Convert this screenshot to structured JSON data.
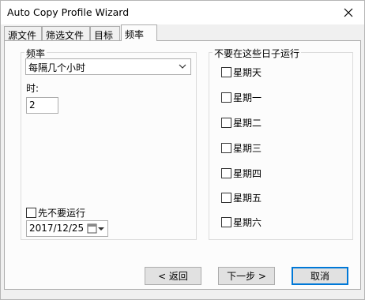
{
  "window": {
    "title": "Auto Copy Profile Wizard"
  },
  "tabs": [
    {
      "label": "源文件"
    },
    {
      "label": "筛选文件"
    },
    {
      "label": "目标"
    },
    {
      "label": "频率"
    }
  ],
  "frequency": {
    "group_label": "频率",
    "select_value": "每隔几个小时",
    "hours_label": "时:",
    "hours_value": "2",
    "dont_run_yet_label": "先不要运行",
    "date_value": "2017/12/25"
  },
  "skip_days": {
    "group_label": "不要在这些日子运行",
    "days": [
      "星期天",
      "星期一",
      "星期二",
      "星期三",
      "星期四",
      "星期五",
      "星期六"
    ]
  },
  "buttons": {
    "back": "< 返回",
    "next": "下一步 >",
    "cancel": "取消"
  }
}
